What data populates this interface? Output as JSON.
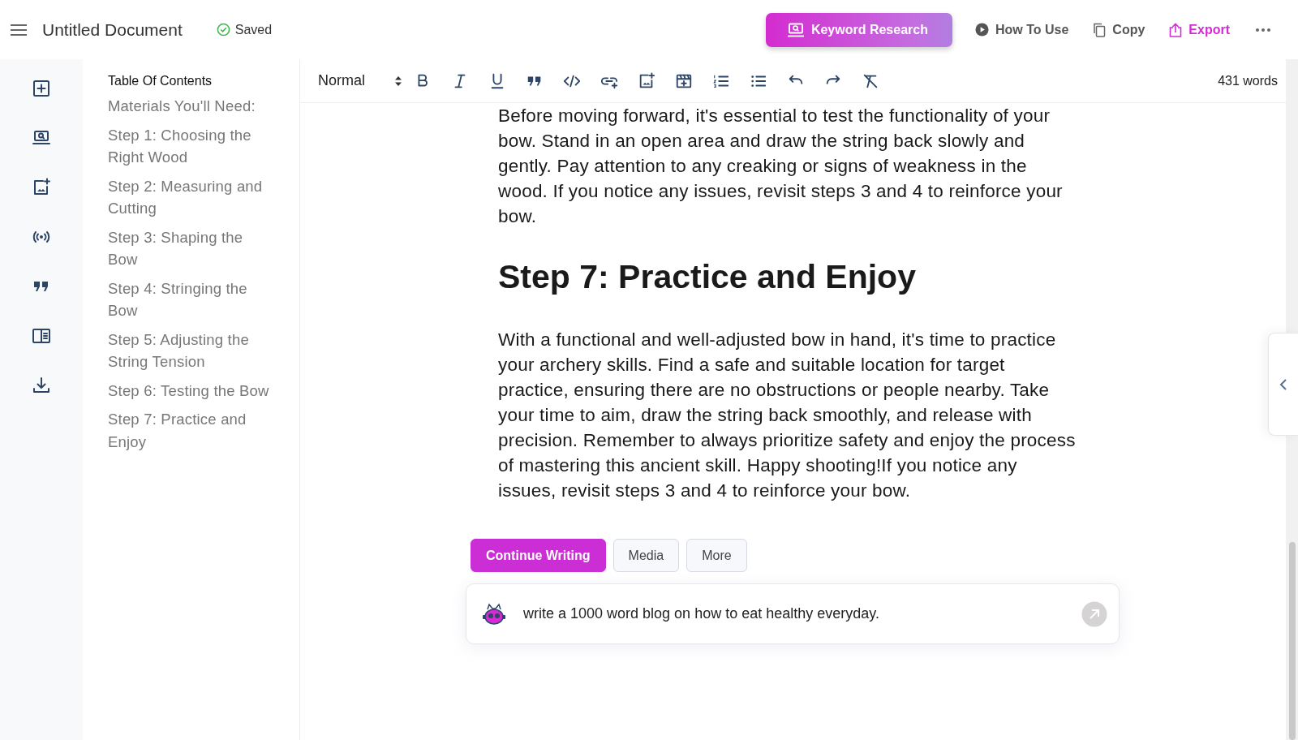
{
  "header": {
    "title": "Untitled Document",
    "save_status": "Saved",
    "actions": [
      {
        "label": "Keyword Research",
        "kind": "primary"
      },
      {
        "label": "How To Use",
        "kind": "play"
      },
      {
        "label": "Copy",
        "kind": "copy"
      },
      {
        "label": "Export",
        "kind": "export"
      }
    ]
  },
  "toc": {
    "title": "Table Of Contents",
    "items": [
      "Materials You'll Need:",
      "Step 1: Choosing the Right Wood",
      "Step 2: Measuring and Cutting",
      "Step 3: Shaping the Bow",
      "Step 4: Stringing the Bow",
      "Step 5: Adjusting the String Tension",
      "Step 6: Testing the Bow",
      "Step 7: Practice and Enjoy"
    ]
  },
  "toolbar": {
    "block_style": "Normal",
    "word_count": "431 words"
  },
  "document": {
    "blocks": [
      {
        "kind": "paragraph",
        "text": "Before moving forward, it's essential to test the functionality of your bow. Stand in an open area and draw the string back slowly and gently. Pay attention to any creaking or signs of weakness in the wood. If you notice any issues, revisit steps 3 and 4 to reinforce your bow."
      },
      {
        "kind": "heading",
        "text": "Step 7: Practice and Enjoy"
      },
      {
        "kind": "paragraph",
        "text": "With a functional and well-adjusted bow in hand, it's time to practice your archery skills. Find a safe and suitable location for target practice, ensuring there are no obstructions or people nearby. Take your time to aim, draw the string back smoothly, and release with precision. Remember to always prioritize safety and enjoy the process of mastering this ancient skill. Happy shooting!If you notice any issues, revisit steps 3 and 4 to reinforce your bow."
      }
    ]
  },
  "assistant": {
    "actions": [
      {
        "label": "Continue Writing",
        "selected": true
      },
      {
        "label": "Media",
        "selected": false
      },
      {
        "label": "More",
        "selected": false
      }
    ],
    "prompt": "write a 1000 word blog on how to eat healthy everyday."
  }
}
